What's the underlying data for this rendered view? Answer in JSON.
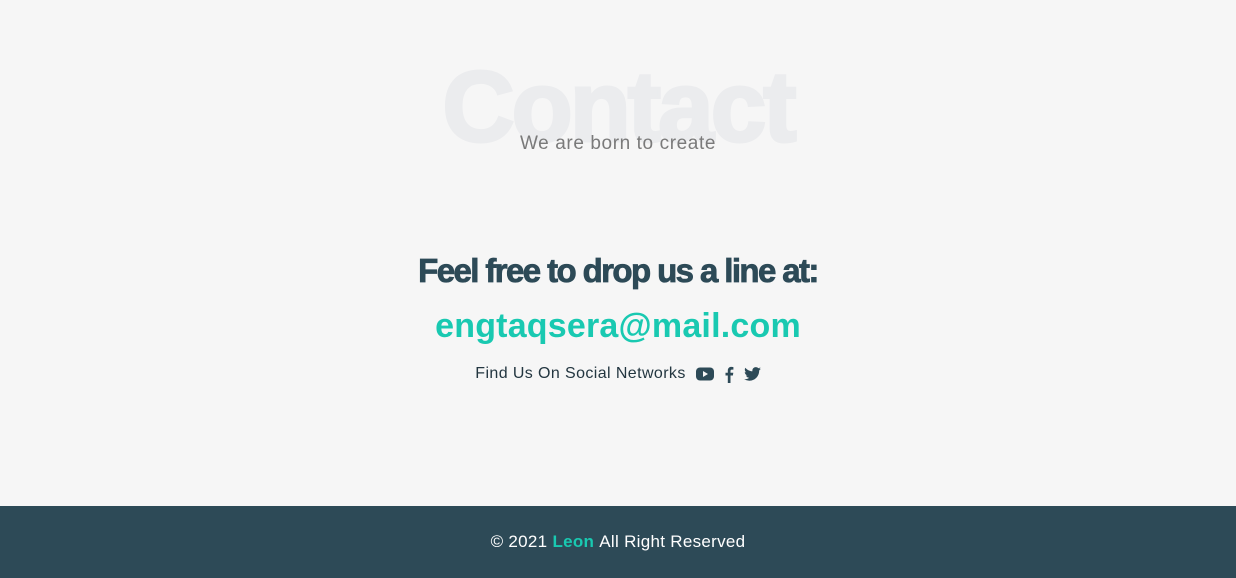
{
  "section": {
    "background_word": "Contact",
    "subtitle": "We are born to create",
    "headline": "Feel free to drop us a line at:",
    "email": "engtaqsera@mail.com",
    "social_label": "Find Us On Social Networks",
    "social_icons": [
      "youtube-icon",
      "facebook-icon",
      "twitter-icon"
    ]
  },
  "footer": {
    "copyright": "© 2021",
    "brand": "Leon",
    "rights": "All Right Reserved"
  },
  "colors": {
    "accent": "#19c9b1",
    "dark": "#2d4a57",
    "background": "#f6f6f6"
  }
}
